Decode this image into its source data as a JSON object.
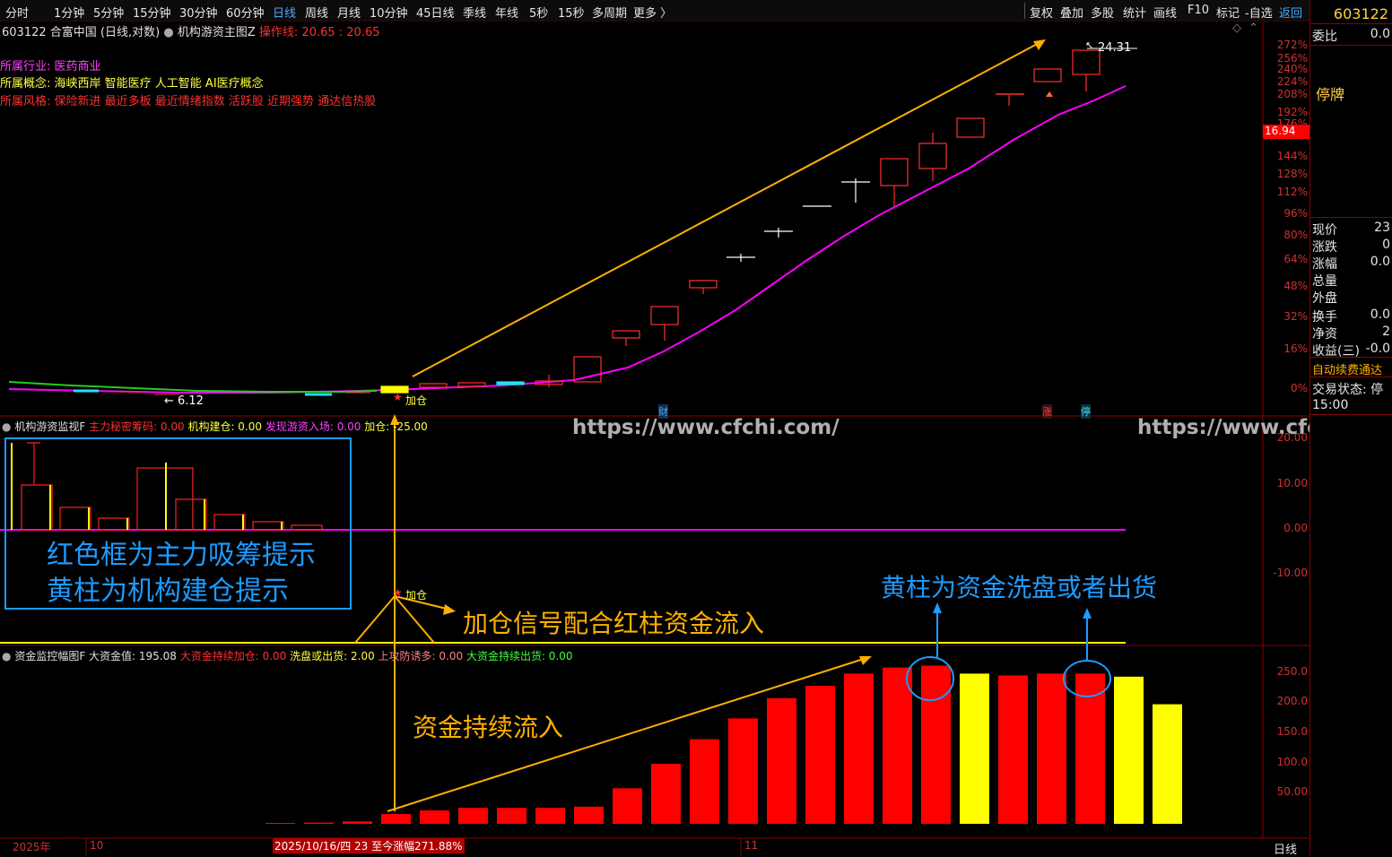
{
  "toolbar": {
    "periods": [
      "分时",
      "1分钟",
      "5分钟",
      "15分钟",
      "30分钟",
      "60分钟",
      "日线",
      "周线",
      "月线",
      "10分钟",
      "45日线",
      "季线",
      "年线",
      "5秒",
      "15秒",
      "多周期",
      "更多 〉"
    ],
    "active": "日线",
    "tools": [
      "复权",
      "叠加",
      "多股",
      "统计",
      "画线",
      "F10",
      "标记",
      "-自选",
      "返回"
    ]
  },
  "header": {
    "code": "603122",
    "name": "合富中国",
    "mode": "(日线,对数)",
    "indicator": "机构游资主图Z",
    "op_label": "操作线:",
    "op_value": "20.65 : 20.65"
  },
  "info": {
    "industry_label": "所属行业:",
    "industry": "医药商业",
    "concept_label": "所属概念:",
    "concepts": "海峡西岸 智能医疗 人工智能 AI医疗概念",
    "style_label": "所属风格:",
    "styles": "保险新进 最近多板 最近情绪指数 活跃股 近期强势 通达信热股"
  },
  "main_chart": {
    "axis_labels": [
      "272%",
      "256%",
      "240%",
      "224%",
      "208%",
      "192%",
      "176%",
      "144%",
      "128%",
      "112%",
      "96%",
      "80%",
      "64%",
      "48%",
      "32%",
      "16%",
      "0%"
    ],
    "price_tag": "16.94",
    "high_label": "24.31",
    "low_label": "6.12",
    "jiacang": "加仓",
    "marker_cai": "财",
    "marker_zhang": "涨",
    "marker_ting": "停",
    "watermark": "https://www.cfchi.com/"
  },
  "panel2": {
    "title": "机构游资监视F",
    "l1": "主力秘密筹码: 0.00",
    "l2": "机构建仓: 0.00",
    "l3": "发现游资入场: 0.00",
    "l4": "加仓: -25.00",
    "axis_labels": [
      "20.00",
      "10.00",
      "0.00",
      "-10.00"
    ],
    "box_line1": "红色框为主力吸筹提示",
    "box_line2": "黄柱为机构建仓提示",
    "jiacang": "加仓",
    "arrow_text": "加仓信号配合红柱资金流入"
  },
  "panel3": {
    "title": "资金监控幅图F",
    "big": "大资金值: 195.08",
    "l1": "大资金持续加仓: 0.00",
    "l2": "洗盘或出货: 2.00",
    "l3": "上攻防诱多: 0.00",
    "l4": "大资金持续出货: 0.00",
    "axis_labels": [
      "250.0",
      "200.0",
      "150.0",
      "100.0",
      "50.00"
    ],
    "flow_text": "资金持续流入",
    "wash_text": "黄柱为资金洗盘或者出货",
    "bar_values": [
      0,
      2,
      4,
      16,
      22,
      26,
      26,
      26,
      28,
      58,
      98,
      138,
      172,
      205,
      225,
      245,
      255,
      258,
      245,
      242,
      245,
      245,
      240,
      195
    ],
    "bar_colors": [
      "red",
      "red",
      "red",
      "red",
      "red",
      "red",
      "red",
      "red",
      "red",
      "red",
      "red",
      "red",
      "red",
      "red",
      "red",
      "red",
      "red",
      "red",
      "yellow",
      "red",
      "red",
      "red",
      "yellow",
      "yellow"
    ]
  },
  "bottom": {
    "year": "2025年",
    "m10": "10",
    "date": "2025/10/16/四 23 至今涨幅271.88%",
    "m11": "11",
    "period": "日线"
  },
  "right_panel": {
    "code": "603122",
    "weibi": "委比",
    "weibi_v": "0.0",
    "halt": "停牌",
    "rows": [
      [
        "现价",
        "23"
      ],
      [
        "涨跌",
        "0"
      ],
      [
        "涨幅",
        "0.0"
      ],
      [
        "总量",
        ""
      ],
      [
        "外盘",
        ""
      ],
      [
        "换手",
        "0.0"
      ],
      [
        "净资",
        "2"
      ],
      [
        "收益(三)",
        "-0.0"
      ]
    ],
    "auto_fee": "自动续费通达",
    "trade_state": "交易状态: 停",
    "time": "15:00"
  },
  "colors": {
    "red": "#ff0000",
    "yellow": "#ffff00",
    "magenta": "#ff00ff",
    "blue": "#1e9bff",
    "orange": "#ffb000"
  }
}
